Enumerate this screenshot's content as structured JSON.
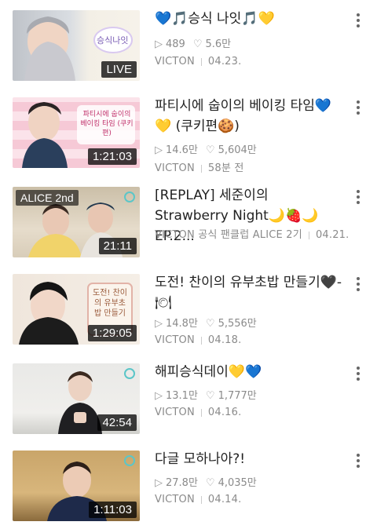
{
  "videos": [
    {
      "title": "💙🎵승식 나잇🎵💛",
      "plays": "489",
      "likes": "5.6만",
      "channel": "VICTON",
      "date": "04.23.",
      "badge": "LIVE",
      "thumb_text": "승식나잇"
    },
    {
      "title": "파티시에 숩이의 베이킹 타임💙💛 (쿠키편🍪)",
      "plays": "14.6만",
      "likes": "5,604만",
      "channel": "VICTON",
      "date": "58분 전",
      "badge": "1:21:03",
      "thumb_text": "파티시에 숩이의 베이킹 타임 (쿠키편)"
    },
    {
      "title": "[REPLAY] 세준이의 Strawberry Night🌙🍓🌙 EP.2...",
      "channel": "VICTON 공식 팬클럽 ALICE 2기",
      "date": "04.21.",
      "badge": "21:11",
      "channel_badge": "ALICE 2nd"
    },
    {
      "title": "도전! 찬이의 유부초밥 만들기🖤-🍽",
      "plays": "14.8만",
      "likes": "5,556만",
      "channel": "VICTON",
      "date": "04.18.",
      "badge": "1:29:05",
      "thumb_text": "도전! 찬이의 유부초밥 만들기"
    },
    {
      "title": "해피승식데이💛💙",
      "plays": "13.1만",
      "likes": "1,777만",
      "channel": "VICTON",
      "date": "04.16.",
      "badge": "42:54"
    },
    {
      "title": "다글 모하나아?!",
      "plays": "27.8만",
      "likes": "4,035만",
      "channel": "VICTON",
      "date": "04.14.",
      "badge": "1:11:03"
    }
  ],
  "icons": {
    "play": "play-icon",
    "heart": "heart-icon",
    "more": "more-vert-icon"
  }
}
